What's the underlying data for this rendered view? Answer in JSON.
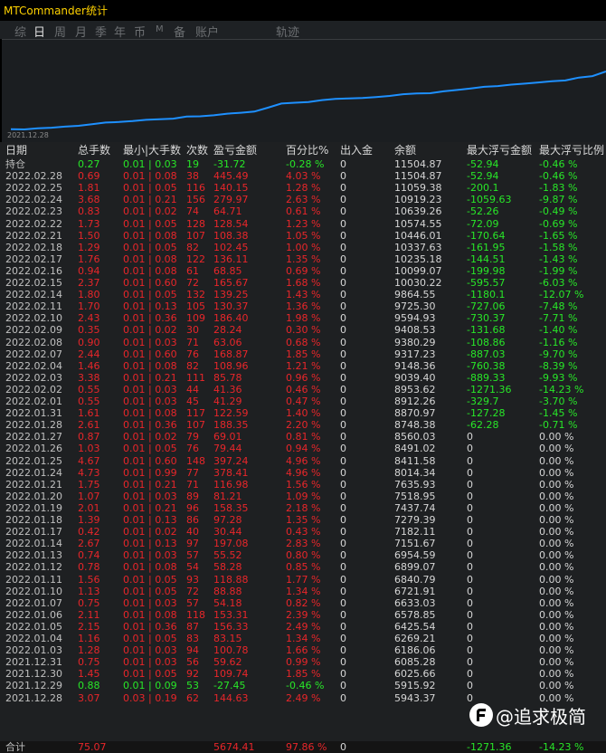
{
  "window": {
    "title": "MTCommander统计"
  },
  "tabs": [
    {
      "label": "综",
      "active": false
    },
    {
      "label": "日",
      "active": true
    },
    {
      "label": "周",
      "active": false
    },
    {
      "label": "月",
      "active": false
    },
    {
      "label": "季",
      "active": false
    },
    {
      "label": "年",
      "active": false
    },
    {
      "label": "币",
      "active": false
    },
    {
      "label": "M",
      "active": false
    },
    {
      "label": "备",
      "active": false
    },
    {
      "label": "账户",
      "active": false
    },
    {
      "label": "轨迹",
      "active": false
    }
  ],
  "chart": {
    "start_label": "2021.12.28",
    "line_color": "#1e90ff"
  },
  "table": {
    "headers": [
      "日期",
      "总手数",
      "最小|大手数",
      "次数",
      "盈亏金额",
      "百分比%",
      "出入金",
      "余额",
      "最大浮亏金额",
      "最大浮亏比例"
    ],
    "rows": [
      [
        "持仓",
        "0.27",
        "0.01 | 0.03",
        "19",
        "-31.72",
        "-0.28 %",
        "0",
        "11504.87",
        "-52.94",
        "-0.46 %"
      ],
      [
        "2022.02.28",
        "0.69",
        "0.01 | 0.08",
        "38",
        "445.49",
        "4.03 %",
        "0",
        "11504.87",
        "-52.94",
        "-0.46 %"
      ],
      [
        "2022.02.25",
        "1.81",
        "0.01 | 0.05",
        "116",
        "140.15",
        "1.28 %",
        "0",
        "11059.38",
        "-200.1",
        "-1.83 %"
      ],
      [
        "2022.02.24",
        "3.68",
        "0.01 | 0.21",
        "156",
        "279.97",
        "2.63 %",
        "0",
        "10919.23",
        "-1059.63",
        "-9.87 %"
      ],
      [
        "2022.02.23",
        "0.83",
        "0.01 | 0.02",
        "74",
        "64.71",
        "0.61 %",
        "0",
        "10639.26",
        "-52.26",
        "-0.49 %"
      ],
      [
        "2022.02.22",
        "1.73",
        "0.01 | 0.05",
        "128",
        "128.54",
        "1.23 %",
        "0",
        "10574.55",
        "-72.09",
        "-0.69 %"
      ],
      [
        "2022.02.21",
        "1.50",
        "0.01 | 0.08",
        "107",
        "108.38",
        "1.05 %",
        "0",
        "10446.01",
        "-170.64",
        "-1.65 %"
      ],
      [
        "2022.02.18",
        "1.29",
        "0.01 | 0.05",
        "82",
        "102.45",
        "1.00 %",
        "0",
        "10337.63",
        "-161.95",
        "-1.58 %"
      ],
      [
        "2022.02.17",
        "1.76",
        "0.01 | 0.08",
        "122",
        "136.11",
        "1.35 %",
        "0",
        "10235.18",
        "-144.51",
        "-1.43 %"
      ],
      [
        "2022.02.16",
        "0.94",
        "0.01 | 0.08",
        "61",
        "68.85",
        "0.69 %",
        "0",
        "10099.07",
        "-199.98",
        "-1.99 %"
      ],
      [
        "2022.02.15",
        "2.37",
        "0.01 | 0.60",
        "72",
        "165.67",
        "1.68 %",
        "0",
        "10030.22",
        "-595.57",
        "-6.03 %"
      ],
      [
        "2022.02.14",
        "1.80",
        "0.01 | 0.05",
        "132",
        "139.25",
        "1.43 %",
        "0",
        "9864.55",
        "-1180.1",
        "-12.07 %"
      ],
      [
        "2022.02.11",
        "1.70",
        "0.01 | 0.13",
        "105",
        "130.37",
        "1.36 %",
        "0",
        "9725.30",
        "-727.06",
        "-7.48 %"
      ],
      [
        "2022.02.10",
        "2.43",
        "0.01 | 0.36",
        "109",
        "186.40",
        "1.98 %",
        "0",
        "9594.93",
        "-730.37",
        "-7.71 %"
      ],
      [
        "2022.02.09",
        "0.35",
        "0.01 | 0.02",
        "30",
        "28.24",
        "0.30 %",
        "0",
        "9408.53",
        "-131.68",
        "-1.40 %"
      ],
      [
        "2022.02.08",
        "0.90",
        "0.01 | 0.03",
        "71",
        "63.06",
        "0.68 %",
        "0",
        "9380.29",
        "-108.86",
        "-1.16 %"
      ],
      [
        "2022.02.07",
        "2.44",
        "0.01 | 0.60",
        "76",
        "168.87",
        "1.85 %",
        "0",
        "9317.23",
        "-887.03",
        "-9.70 %"
      ],
      [
        "2022.02.04",
        "1.46",
        "0.01 | 0.08",
        "82",
        "108.96",
        "1.21 %",
        "0",
        "9148.36",
        "-760.38",
        "-8.39 %"
      ],
      [
        "2022.02.03",
        "3.38",
        "0.01 | 0.21",
        "111",
        "85.78",
        "0.96 %",
        "0",
        "9039.40",
        "-889.33",
        "-9.93 %"
      ],
      [
        "2022.02.02",
        "0.55",
        "0.01 | 0.03",
        "44",
        "41.36",
        "0.46 %",
        "0",
        "8953.62",
        "-1271.36",
        "-14.23 %"
      ],
      [
        "2022.02.01",
        "0.55",
        "0.01 | 0.03",
        "45",
        "41.29",
        "0.47 %",
        "0",
        "8912.26",
        "-329.7",
        "-3.70 %"
      ],
      [
        "2022.01.31",
        "1.61",
        "0.01 | 0.08",
        "117",
        "122.59",
        "1.40 %",
        "0",
        "8870.97",
        "-127.28",
        "-1.45 %"
      ],
      [
        "2022.01.28",
        "2.61",
        "0.01 | 0.36",
        "107",
        "188.35",
        "2.20 %",
        "0",
        "8748.38",
        "-62.28",
        "-0.71 %"
      ],
      [
        "2022.01.27",
        "0.87",
        "0.01 | 0.02",
        "79",
        "69.01",
        "0.81 %",
        "0",
        "8560.03",
        "0",
        "0.00 %"
      ],
      [
        "2022.01.26",
        "1.03",
        "0.01 | 0.05",
        "76",
        "79.44",
        "0.94 %",
        "0",
        "8491.02",
        "0",
        "0.00 %"
      ],
      [
        "2022.01.25",
        "4.67",
        "0.01 | 0.60",
        "148",
        "397.24",
        "4.96 %",
        "0",
        "8411.58",
        "0",
        "0.00 %"
      ],
      [
        "2022.01.24",
        "4.73",
        "0.01 | 0.99",
        "77",
        "378.41",
        "4.96 %",
        "0",
        "8014.34",
        "0",
        "0.00 %"
      ],
      [
        "2022.01.21",
        "1.75",
        "0.01 | 0.21",
        "71",
        "116.98",
        "1.56 %",
        "0",
        "7635.93",
        "0",
        "0.00 %"
      ],
      [
        "2022.01.20",
        "1.07",
        "0.01 | 0.03",
        "89",
        "81.21",
        "1.09 %",
        "0",
        "7518.95",
        "0",
        "0.00 %"
      ],
      [
        "2022.01.19",
        "2.01",
        "0.01 | 0.21",
        "96",
        "158.35",
        "2.18 %",
        "0",
        "7437.74",
        "0",
        "0.00 %"
      ],
      [
        "2022.01.18",
        "1.39",
        "0.01 | 0.13",
        "86",
        "97.28",
        "1.35 %",
        "0",
        "7279.39",
        "0",
        "0.00 %"
      ],
      [
        "2022.01.17",
        "0.42",
        "0.01 | 0.02",
        "40",
        "30.44",
        "0.43 %",
        "0",
        "7182.11",
        "0",
        "0.00 %"
      ],
      [
        "2022.01.14",
        "2.67",
        "0.01 | 0.13",
        "97",
        "197.08",
        "2.83 %",
        "0",
        "7151.67",
        "0",
        "0.00 %"
      ],
      [
        "2022.01.13",
        "0.74",
        "0.01 | 0.03",
        "57",
        "55.52",
        "0.80 %",
        "0",
        "6954.59",
        "0",
        "0.00 %"
      ],
      [
        "2022.01.12",
        "0.78",
        "0.01 | 0.08",
        "54",
        "58.28",
        "0.85 %",
        "0",
        "6899.07",
        "0",
        "0.00 %"
      ],
      [
        "2022.01.11",
        "1.56",
        "0.01 | 0.05",
        "93",
        "118.88",
        "1.77 %",
        "0",
        "6840.79",
        "0",
        "0.00 %"
      ],
      [
        "2022.01.10",
        "1.13",
        "0.01 | 0.05",
        "72",
        "88.88",
        "1.34 %",
        "0",
        "6721.91",
        "0",
        "0.00 %"
      ],
      [
        "2022.01.07",
        "0.75",
        "0.01 | 0.03",
        "57",
        "54.18",
        "0.82 %",
        "0",
        "6633.03",
        "0",
        "0.00 %"
      ],
      [
        "2022.01.06",
        "2.11",
        "0.01 | 0.08",
        "118",
        "153.31",
        "2.39 %",
        "0",
        "6578.85",
        "0",
        "0.00 %"
      ],
      [
        "2022.01.05",
        "2.15",
        "0.01 | 0.36",
        "87",
        "156.33",
        "2.49 %",
        "0",
        "6425.54",
        "0",
        "0.00 %"
      ],
      [
        "2022.01.04",
        "1.16",
        "0.01 | 0.05",
        "83",
        "83.15",
        "1.34 %",
        "0",
        "6269.21",
        "0",
        "0.00 %"
      ],
      [
        "2022.01.03",
        "1.28",
        "0.01 | 0.03",
        "94",
        "100.78",
        "1.66 %",
        "0",
        "6186.06",
        "0",
        "0.00 %"
      ],
      [
        "2021.12.31",
        "0.75",
        "0.01 | 0.03",
        "56",
        "59.62",
        "0.99 %",
        "0",
        "6085.28",
        "0",
        "0.00 %"
      ],
      [
        "2021.12.30",
        "1.45",
        "0.01 | 0.05",
        "92",
        "109.74",
        "1.85 %",
        "0",
        "6025.66",
        "0",
        "0.00 %"
      ],
      [
        "2021.12.29",
        "0.88",
        "0.01 | 0.09",
        "53",
        "-27.45",
        "-0.46 %",
        "0",
        "5915.92",
        "0",
        "0.00 %"
      ],
      [
        "2021.12.28",
        "3.07",
        "0.03 | 0.19",
        "62",
        "144.63",
        "2.49 %",
        "0",
        "5943.37",
        "0",
        "0.00 %"
      ]
    ],
    "total": [
      "合计",
      "75.07",
      "",
      "",
      "5674.41",
      "97.86 %",
      "0",
      "",
      "-1271.36",
      "-14.23 %"
    ]
  },
  "watermark": {
    "text": "@追求极简"
  }
}
